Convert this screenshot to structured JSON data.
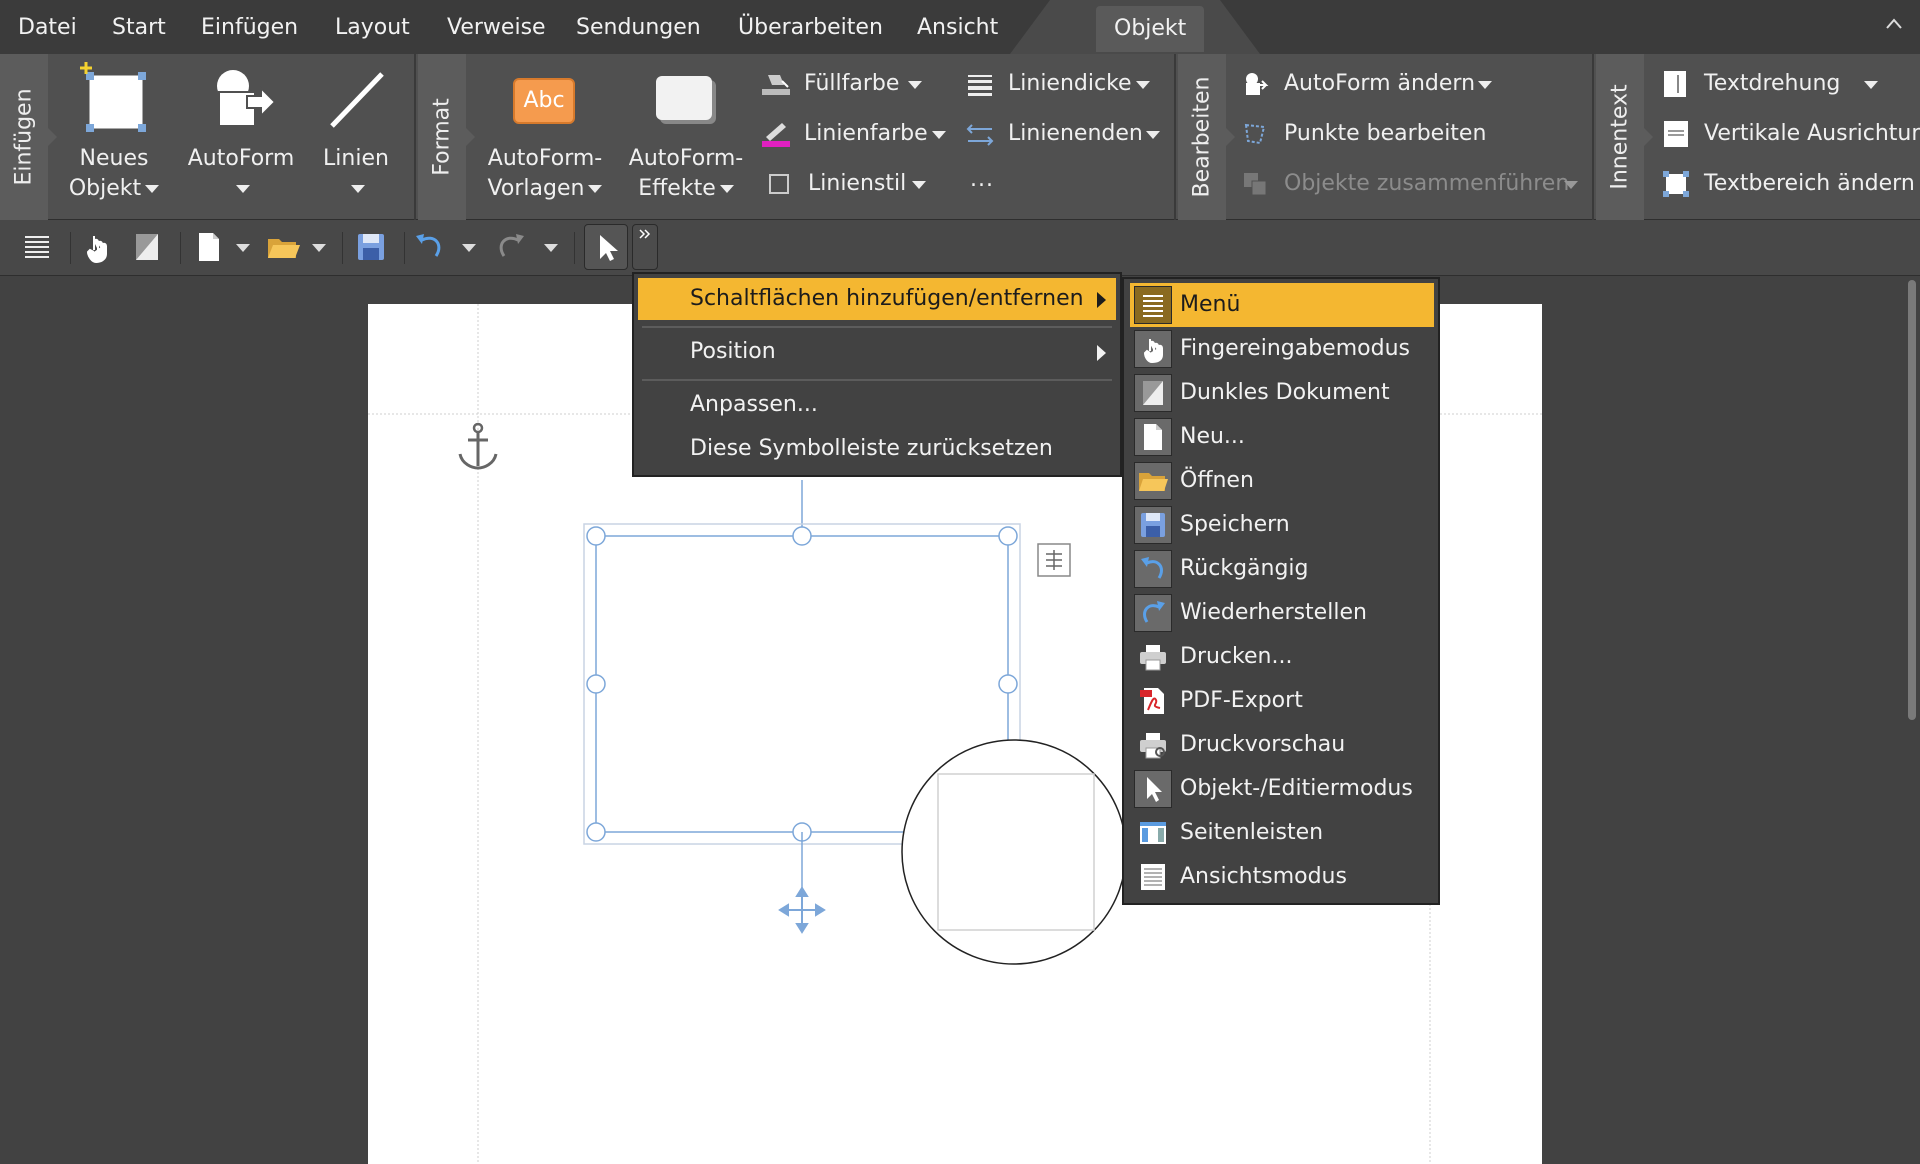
{
  "menubar": {
    "items": [
      "Datei",
      "Start",
      "Einfügen",
      "Layout",
      "Verweise",
      "Sendungen",
      "Überarbeiten",
      "Ansicht"
    ],
    "active_tab": "Objekt"
  },
  "ribbon": {
    "groups": {
      "insert": "Einfügen",
      "format": "Format",
      "edit": "Bearbeiten",
      "innertext": "Innentext"
    },
    "new_object": {
      "line1": "Neues",
      "line2": "Objekt"
    },
    "autoform": "AutoForm",
    "lines": "Linien",
    "autoform_templates": {
      "line1": "AutoForm-",
      "line2": "Vorlagen"
    },
    "autoform_effects": {
      "line1": "AutoForm-",
      "line2": "Effekte"
    },
    "fill_color": "Füllfarbe",
    "line_color": "Linienfarbe",
    "line_style": "Linienstil",
    "line_width": "Liniendicke",
    "line_ends": "Linienenden",
    "more": "...",
    "change_autoform": "AutoForm ändern",
    "edit_points": "Punkte bearbeiten",
    "merge_objects": "Objekte zusammenführen",
    "text_rotation": "Textdrehung",
    "vertical_alignment": "Vertikale Ausrichtung",
    "change_text_area": "Textbereich ändern",
    "abc": "Abc"
  },
  "context_menu": {
    "add_remove": "Schaltflächen hinzufügen/entfernen",
    "position": "Position",
    "customize": "Anpassen...",
    "reset": "Diese Symbolleiste zurücksetzen"
  },
  "submenu": {
    "items": [
      "Menü",
      "Fingereingabemodus",
      "Dunkles Dokument",
      "Neu...",
      "Öffnen",
      "Speichern",
      "Rückgängig",
      "Wiederherstellen",
      "Drucken...",
      "PDF-Export",
      "Druckvorschau",
      "Objekt-/Editiermodus",
      "Seitenleisten",
      "Ansichtsmodus"
    ]
  },
  "colors": {
    "accent": "#f4b731",
    "selection": "#7da7d9"
  }
}
